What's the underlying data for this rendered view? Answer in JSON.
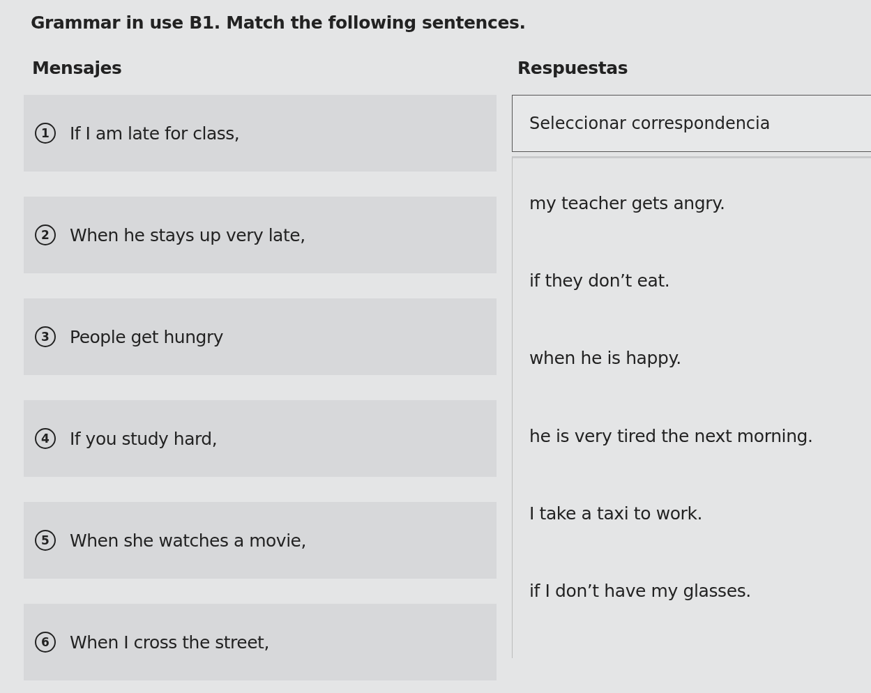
{
  "title": "Grammar in use B1. Match the following sentences.",
  "columns": {
    "left": "Mensajes",
    "right": "Respuestas"
  },
  "dropdown": {
    "placeholder": "Seleccionar correspondencia"
  },
  "messages": [
    {
      "number": "1",
      "text": "If I am late for class,"
    },
    {
      "number": "2",
      "text": "When he stays up very late,"
    },
    {
      "number": "3",
      "text": "People get hungry"
    },
    {
      "number": "4",
      "text": "If you study hard,"
    },
    {
      "number": "5",
      "text": "When she watches a movie,"
    },
    {
      "number": "6",
      "text": "When I cross the street,"
    }
  ],
  "answers": [
    "my teacher gets angry.",
    "if they don’t eat.",
    "when he is happy.",
    "he is very tired the next morning.",
    "I take a taxi to work.",
    "if I don’t have my glasses."
  ]
}
